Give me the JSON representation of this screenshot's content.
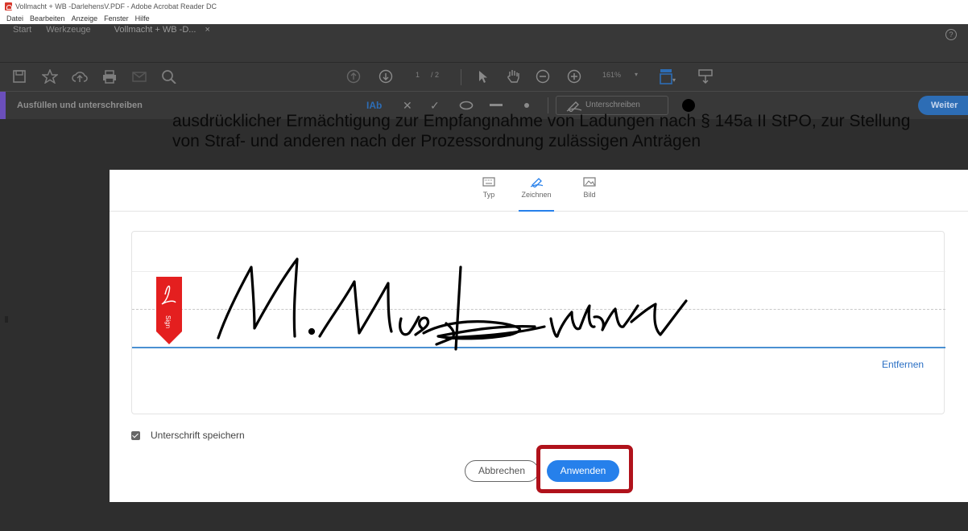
{
  "window": {
    "title": "Vollmacht + WB -DarlehensV.PDF - Adobe Acrobat Reader DC"
  },
  "menubar": [
    "Datei",
    "Bearbeiten",
    "Anzeige",
    "Fenster",
    "Hilfe"
  ],
  "tabs": {
    "start": "Start",
    "tools": "Werkzeuge",
    "document": "Vollmacht + WB -D...",
    "close": "×"
  },
  "help": "?",
  "toolbar": {
    "page_current": "1",
    "page_total": "/ 2",
    "zoom": "161%"
  },
  "fillsign": {
    "title": "Ausfüllen und unterschreiben",
    "text_tool": "IAb",
    "sign_label": "Unterschreiben",
    "next_label": "Weiter"
  },
  "document": {
    "line1": "ausdrücklicher Ermächtigung zur Empfangnahme von Ladungen nach § 145a II StPO, zur Stellung",
    "line2": "von Straf- und anderen nach der Prozessordnung zulässigen Anträgen"
  },
  "dialog": {
    "tabs": {
      "type": "Typ",
      "draw": "Zeichnen",
      "image": "Bild"
    },
    "sign_marker": "Sign",
    "remove_label": "Entfernen",
    "save_signature": "Unterschrift speichern",
    "cancel": "Abbrechen",
    "apply": "Anwenden"
  },
  "colors": {
    "accent_blue": "#2680eb",
    "highlight_red": "#b0121b",
    "adobe_red": "#e41f1f",
    "dark_ui": "#383838"
  }
}
